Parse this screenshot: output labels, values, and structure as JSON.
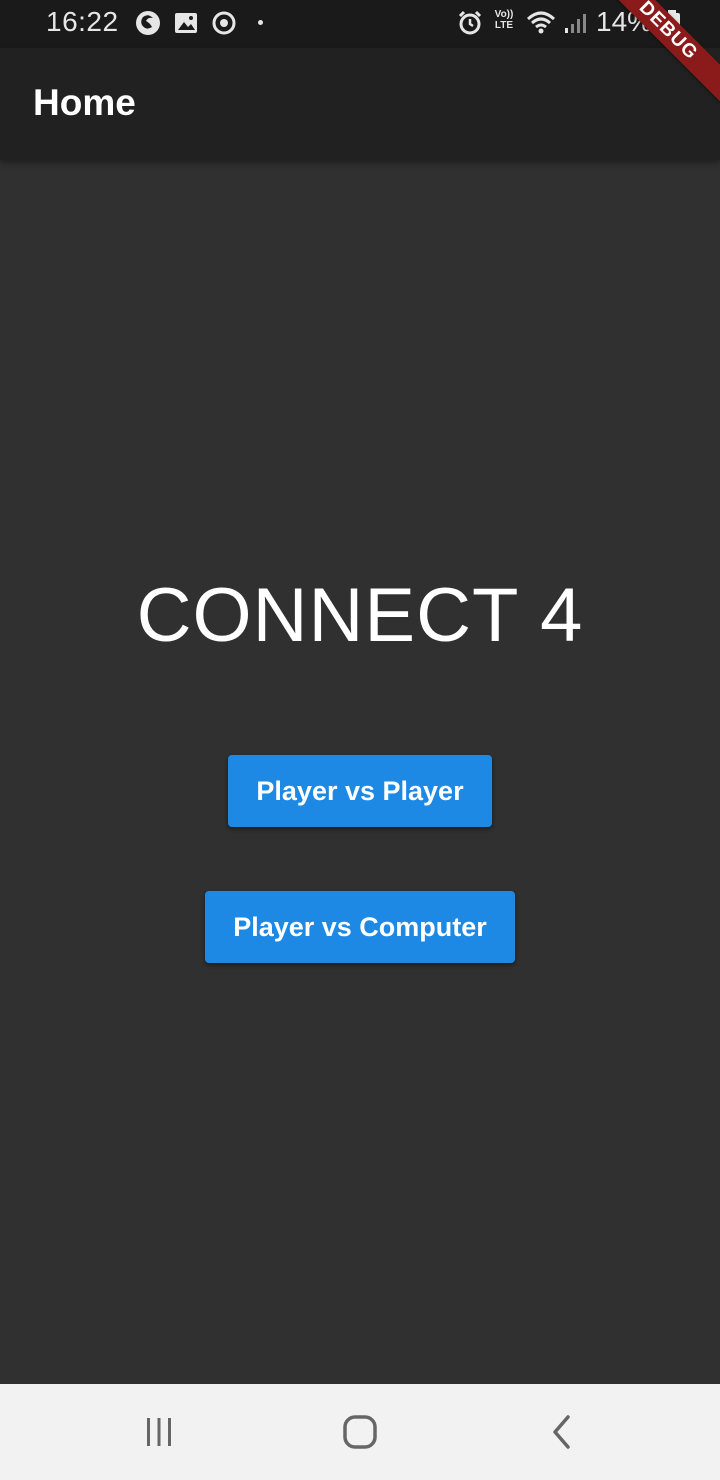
{
  "status_bar": {
    "time": "16:22",
    "battery": "14%",
    "icons": [
      "firefox-icon",
      "gallery-icon",
      "sync-icon",
      "notification-dot",
      "alarm-icon",
      "volte-icon",
      "wifi-icon",
      "signal-icon",
      "battery-icon"
    ],
    "volte_label": "Vo))",
    "lte_label": "LTE"
  },
  "app_bar": {
    "title": "Home",
    "background": "#212121"
  },
  "debug_banner": {
    "label": "DEBUG",
    "color": "#8b1a1a"
  },
  "main": {
    "title": "CONNECT 4",
    "background": "#303030",
    "buttons": [
      {
        "label": "Player vs Player"
      },
      {
        "label": "Player vs Computer"
      }
    ],
    "button_color": "#1e88e5"
  },
  "nav_bar": {
    "items": [
      "recent-apps-icon",
      "home-icon",
      "back-icon"
    ]
  }
}
